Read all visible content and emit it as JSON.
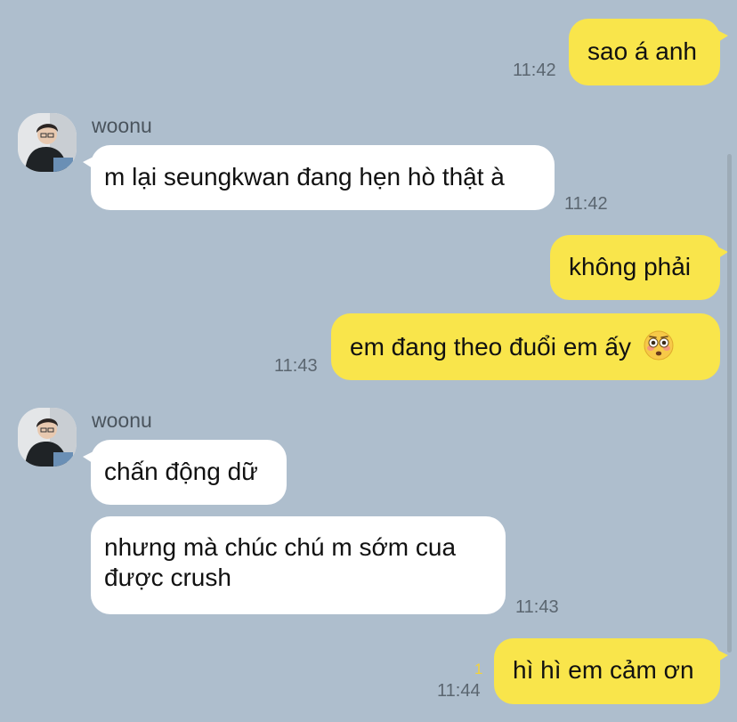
{
  "messages": [
    {
      "dir": "out",
      "text": "sao á anh",
      "time": "11:42"
    },
    {
      "dir": "in",
      "sender": "woonu",
      "text": "m lại seungkwan đang hẹn hò thật à",
      "time": "11:42"
    },
    {
      "dir": "out",
      "text": "không phải"
    },
    {
      "dir": "out",
      "text": "em đang theo đuổi em ấy",
      "emoji": "flushed-face-icon",
      "time": "11:43"
    },
    {
      "dir": "in",
      "sender": "woonu",
      "text": "chấn động dữ"
    },
    {
      "dir": "in",
      "text_line1": "nhưng mà chúc chú m sớm cua",
      "text_line2": "được crush",
      "time": "11:43"
    },
    {
      "dir": "out",
      "text": "hì hì em cảm ơn",
      "unread": "1",
      "time": "11:44"
    }
  ],
  "colors": {
    "background": "#aebecd",
    "outgoing": "#f9e54b",
    "incoming": "#ffffff",
    "unread": "#f3d23b"
  }
}
